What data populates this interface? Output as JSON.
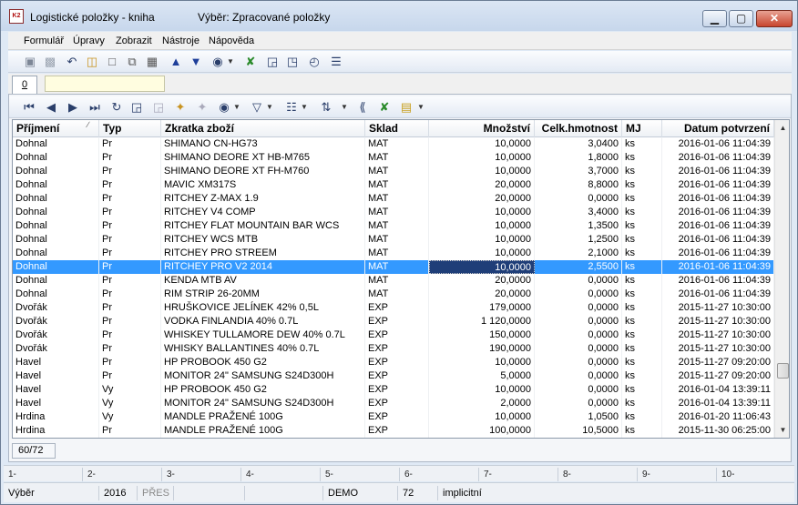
{
  "window": {
    "title": "Logistické položky - kniha",
    "selection_label": "Výběr: Zpracované položky",
    "app_icon_text": "K2",
    "minimize": "▁",
    "maximize": "▢",
    "close": "✕"
  },
  "menu": [
    {
      "label": "Formulář",
      "underline": "F"
    },
    {
      "label": "Úpravy",
      "underline": "Ú"
    },
    {
      "label": "Zobrazit",
      "underline": "Z"
    },
    {
      "label": "Nástroje",
      "underline": "N"
    },
    {
      "label": "Nápověda",
      "underline": "á"
    }
  ],
  "tab": {
    "label": "0"
  },
  "grid": {
    "columns": [
      "Příjmení",
      "Typ",
      "Zkratka zboží",
      "Sklad",
      "Množství",
      "Celk.hmotnost",
      "MJ",
      "Datum potvrzení"
    ],
    "rows": [
      [
        "Dohnal",
        "Pr",
        "SHIMANO CN-HG73",
        "MAT",
        "10,0000",
        "3,0400",
        "ks",
        "2016-01-06 11:04:39"
      ],
      [
        "Dohnal",
        "Pr",
        "SHIMANO DEORE XT HB-M765",
        "MAT",
        "10,0000",
        "1,8000",
        "ks",
        "2016-01-06 11:04:39"
      ],
      [
        "Dohnal",
        "Pr",
        "SHIMANO DEORE XT FH-M760",
        "MAT",
        "10,0000",
        "3,7000",
        "ks",
        "2016-01-06 11:04:39"
      ],
      [
        "Dohnal",
        "Pr",
        "MAVIC XM317S",
        "MAT",
        "20,0000",
        "8,8000",
        "ks",
        "2016-01-06 11:04:39"
      ],
      [
        "Dohnal",
        "Pr",
        "RITCHEY Z-MAX 1.9",
        "MAT",
        "20,0000",
        "0,0000",
        "ks",
        "2016-01-06 11:04:39"
      ],
      [
        "Dohnal",
        "Pr",
        "RITCHEY V4 COMP",
        "MAT",
        "10,0000",
        "3,4000",
        "ks",
        "2016-01-06 11:04:39"
      ],
      [
        "Dohnal",
        "Pr",
        "RITCHEY FLAT MOUNTAIN BAR WCS",
        "MAT",
        "10,0000",
        "1,3500",
        "ks",
        "2016-01-06 11:04:39"
      ],
      [
        "Dohnal",
        "Pr",
        "RITCHEY WCS MTB",
        "MAT",
        "10,0000",
        "1,2500",
        "ks",
        "2016-01-06 11:04:39"
      ],
      [
        "Dohnal",
        "Pr",
        "RITCHEY PRO STREEM",
        "MAT",
        "10,0000",
        "2,1000",
        "ks",
        "2016-01-06 11:04:39"
      ],
      [
        "Dohnal",
        "Pr",
        "RITCHEY PRO V2 2014",
        "MAT",
        "10,0000",
        "2,5500",
        "ks",
        "2016-01-06 11:04:39"
      ],
      [
        "Dohnal",
        "Pr",
        "KENDA MTB AV",
        "MAT",
        "20,0000",
        "0,0000",
        "ks",
        "2016-01-06 11:04:39"
      ],
      [
        "Dohnal",
        "Pr",
        "RIM STRIP 26-20MM",
        "MAT",
        "20,0000",
        "0,0000",
        "ks",
        "2016-01-06 11:04:39"
      ],
      [
        "Dvořák",
        "Pr",
        "HRUŠKOVICE JELÍNEK 42% 0,5L",
        "EXP",
        "179,0000",
        "0,0000",
        "ks",
        "2015-11-27 10:30:00"
      ],
      [
        "Dvořák",
        "Pr",
        "VODKA FINLANDIA 40% 0.7L",
        "EXP",
        "1 120,0000",
        "0,0000",
        "ks",
        "2015-11-27 10:30:00"
      ],
      [
        "Dvořák",
        "Pr",
        "WHISKEY TULLAMORE DEW 40% 0.7L",
        "EXP",
        "150,0000",
        "0,0000",
        "ks",
        "2015-11-27 10:30:00"
      ],
      [
        "Dvořák",
        "Pr",
        "WHISKY BALLANTINES 40% 0.7L",
        "EXP",
        "190,0000",
        "0,0000",
        "ks",
        "2015-11-27 10:30:00"
      ],
      [
        "Havel",
        "Pr",
        "HP PROBOOK 450 G2",
        "EXP",
        "10,0000",
        "0,0000",
        "ks",
        "2015-11-27 09:20:00"
      ],
      [
        "Havel",
        "Pr",
        "MONITOR 24\" SAMSUNG S24D300H",
        "EXP",
        "5,0000",
        "0,0000",
        "ks",
        "2015-11-27 09:20:00"
      ],
      [
        "Havel",
        "Vy",
        "HP PROBOOK 450 G2",
        "EXP",
        "10,0000",
        "0,0000",
        "ks",
        "2016-01-04 13:39:11"
      ],
      [
        "Havel",
        "Vy",
        "MONITOR 24\" SAMSUNG S24D300H",
        "EXP",
        "2,0000",
        "0,0000",
        "ks",
        "2016-01-04 13:39:11"
      ],
      [
        "Hrdina",
        "Vy",
        "MANDLE PRAŽENÉ 100G",
        "EXP",
        "10,0000",
        "1,0500",
        "ks",
        "2016-01-20 11:06:43"
      ],
      [
        "Hrdina",
        "Pr",
        "MANDLE PRAŽENÉ 100G",
        "EXP",
        "100,0000",
        "10,5000",
        "ks",
        "2015-11-30 06:25:00"
      ]
    ],
    "selected_row": 9,
    "sort_indicator": "∕"
  },
  "record_count": "60/72",
  "fkeys": [
    "1-",
    "2-",
    "3-",
    "4-",
    "5-",
    "6-",
    "7-",
    "8-",
    "9-",
    "10-"
  ],
  "status": {
    "mode": "Výběr",
    "year": "2016",
    "pres": "PŘES",
    "empty1": "",
    "empty2": "",
    "db": "DEMO",
    "count": "72",
    "layout": "implicitní"
  },
  "icons": {
    "toolbar1": [
      "save-icon",
      "save-all-icon",
      "undo-icon",
      "open-folder-icon",
      "new-document-icon",
      "copy-icon",
      "book-icon",
      "arrow-up-icon",
      "arrow-down-icon",
      "camera-icon",
      "excel-icon",
      "binoculars-icon",
      "binoculars-next-icon",
      "binoculars-prev-icon",
      "menu-icon"
    ],
    "toolbar2": [
      "first-record-icon",
      "prev-record-icon",
      "next-record-icon",
      "last-record-icon",
      "refresh-icon",
      "search-icon",
      "search-disabled-icon",
      "new-record-icon",
      "edit-record-icon",
      "camera-icon",
      "filter-icon",
      "columns-icon",
      "sort-icon",
      "group-icon",
      "export-excel-icon",
      "report-icon"
    ]
  }
}
